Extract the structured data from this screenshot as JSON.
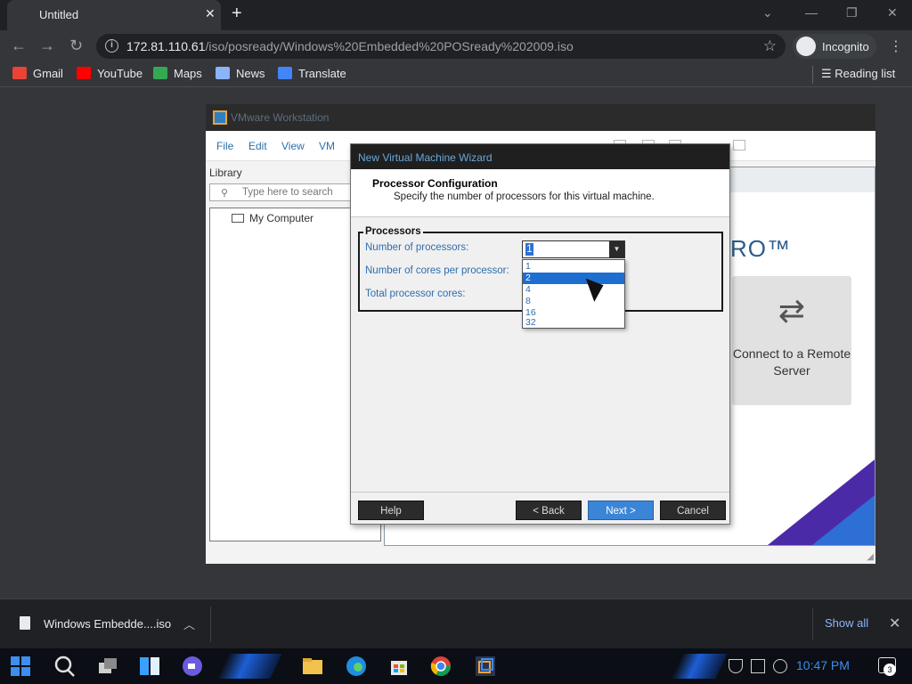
{
  "browser": {
    "tab_title": "Untitled",
    "url_host": "172.81.110.61",
    "url_path": "/iso/posready/Windows%20Embedded%20POSready%202009.iso",
    "incognito_label": "Incognito",
    "bookmarks": [
      {
        "label": "Gmail",
        "icon": "gmail-icon",
        "color": "#ea4335"
      },
      {
        "label": "YouTube",
        "icon": "youtube-icon",
        "color": "#ff0000"
      },
      {
        "label": "Maps",
        "icon": "maps-icon",
        "color": "#34a853"
      },
      {
        "label": "News",
        "icon": "news-icon",
        "color": "#8ab4f8"
      },
      {
        "label": "Translate",
        "icon": "translate-icon",
        "color": "#4285f4"
      }
    ],
    "reading_list": "Reading list"
  },
  "vmware": {
    "title": "VMware Workstation",
    "menus": [
      "File",
      "Edit",
      "View",
      "VM"
    ],
    "library_label": "Library",
    "search_placeholder": "Type here to search",
    "tree_item": "My Computer",
    "pro_text": "RO™",
    "connect_label": "Connect to a Remote Server"
  },
  "wizard": {
    "title": "New Virtual Machine Wizard",
    "heading": "Processor Configuration",
    "subheading": "Specify the number of processors for this virtual machine.",
    "group_label": "Processors",
    "fields": {
      "num_processors": "Number of processors:",
      "cores_per_processor": "Number of cores per processor:",
      "total_cores": "Total processor cores:"
    },
    "selected_value": "1",
    "dropdown_options": [
      "1",
      "2",
      "4",
      "8",
      "16",
      "32"
    ],
    "highlighted_option": "2",
    "buttons": {
      "help": "Help",
      "back": "< Back",
      "next": "Next >",
      "cancel": "Cancel"
    }
  },
  "downloads": {
    "file_name": "Windows Embedde....iso",
    "show_all": "Show all"
  },
  "taskbar": {
    "time": "10:47 PM",
    "notification_count": "3"
  }
}
